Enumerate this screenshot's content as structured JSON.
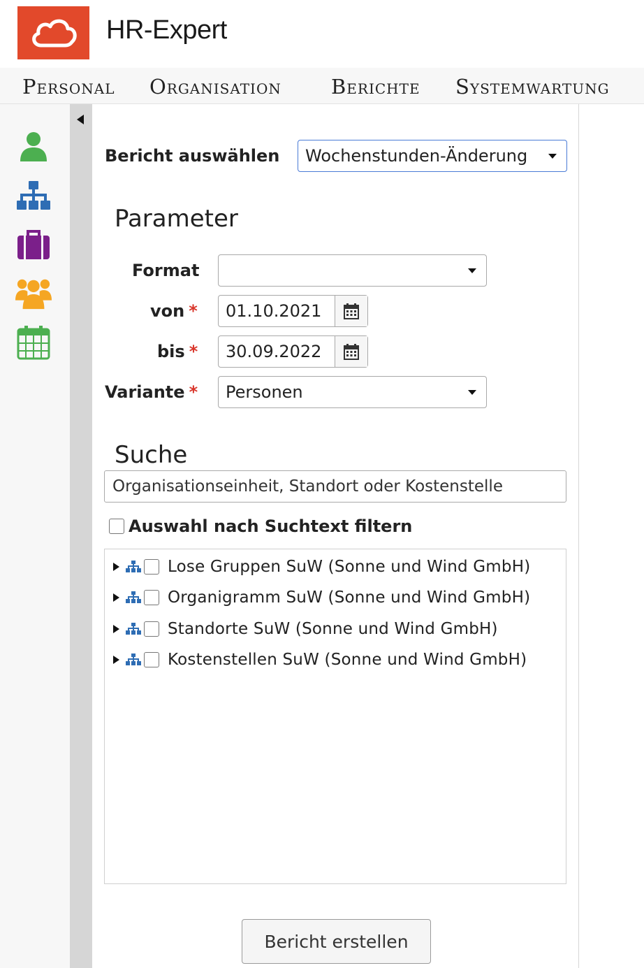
{
  "app": {
    "title": "HR-Expert"
  },
  "menu": [
    {
      "label": "Personal"
    },
    {
      "label": "Organisation"
    },
    {
      "label": "Berichte"
    },
    {
      "label": "Systemwartung"
    }
  ],
  "rail": {
    "icons": [
      {
        "name": "person-icon",
        "color": "#4caf50"
      },
      {
        "name": "org-chart-icon",
        "color": "#2e6db4"
      },
      {
        "name": "briefcase-icon",
        "color": "#7b1f8a"
      },
      {
        "name": "group-icon",
        "color": "#f5a623"
      },
      {
        "name": "calendar-icon",
        "color": "#4caf50"
      }
    ]
  },
  "report": {
    "label": "Bericht auswählen",
    "selected": "Wochenstunden-Änderung"
  },
  "parameter": {
    "heading": "Parameter",
    "format_label": "Format",
    "format_value": "",
    "von_label": "von",
    "von_value": "01.10.2021",
    "bis_label": "bis",
    "bis_value": "30.09.2022",
    "variante_label": "Variante",
    "variante_value": "Personen",
    "required_mark": "*"
  },
  "search": {
    "heading": "Suche",
    "placeholder": "Organisationseinheit, Standort oder Kostenstelle",
    "filter_label": "Auswahl nach Suchtext filtern"
  },
  "tree": {
    "items": [
      {
        "label": "Lose Gruppen SuW (Sonne und Wind GmbH)"
      },
      {
        "label": "Organigramm SuW (Sonne und Wind GmbH)"
      },
      {
        "label": "Standorte SuW (Sonne und Wind GmbH)"
      },
      {
        "label": "Kostenstellen SuW (Sonne und Wind GmbH)"
      }
    ]
  },
  "actions": {
    "create_label": "Bericht erstellen"
  },
  "colors": {
    "accent": "#e2492b",
    "required": "#d9362b",
    "focus_border": "#4a7bd6"
  }
}
